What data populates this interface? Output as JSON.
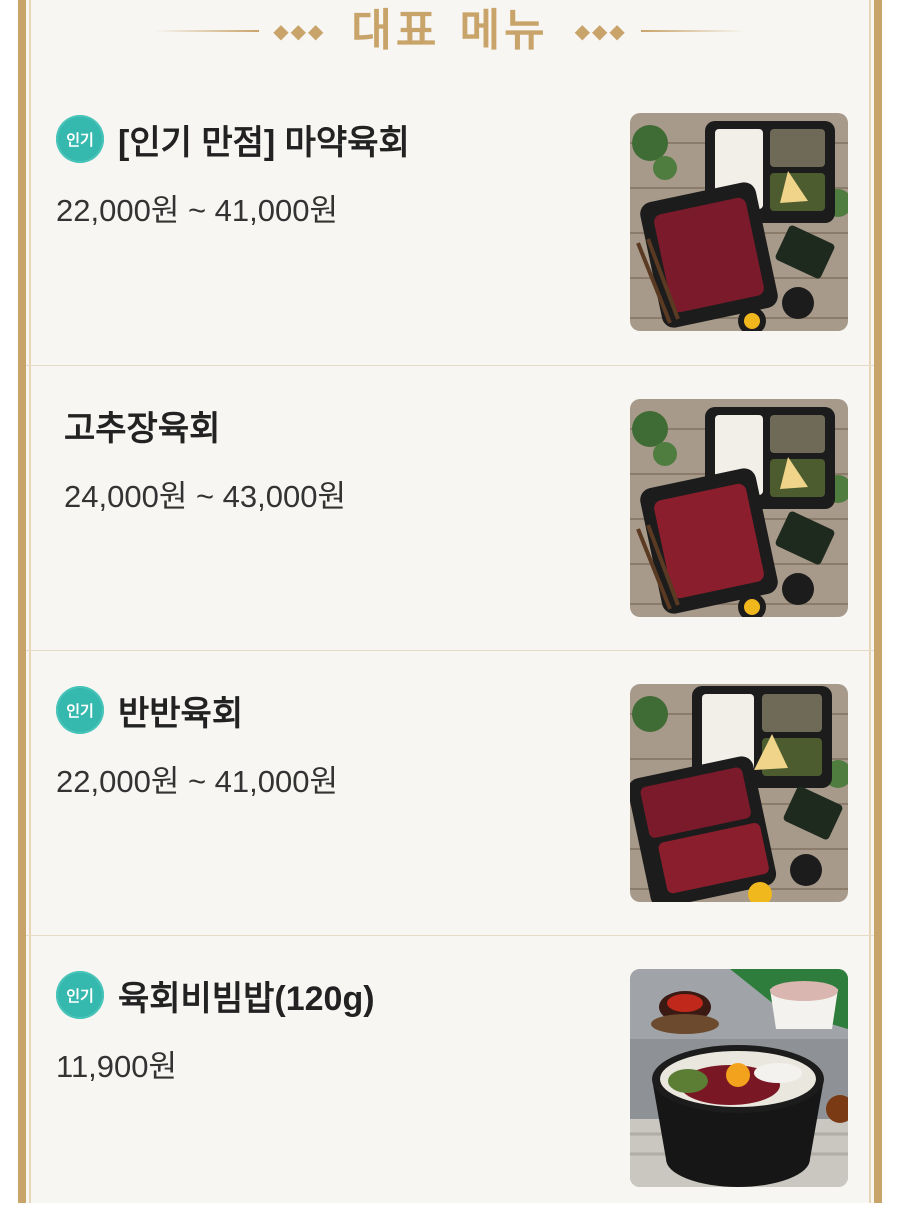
{
  "header": {
    "title": "대표 메뉴",
    "ornament_left": "◆◆◆",
    "ornament_right": "◆◆◆"
  },
  "colors": {
    "gold": "#c9a46a",
    "badge": "#35b8ad",
    "text": "#222222"
  },
  "menu": [
    {
      "badge": "인기",
      "name": "[인기 만점] 마약육회",
      "price": "22,000원 ~ 41,000원",
      "image": "yukhoe-set-icon"
    },
    {
      "badge": "",
      "name": "고추장육회",
      "price": "24,000원 ~ 43,000원",
      "image": "yukhoe-set-icon"
    },
    {
      "badge": "인기",
      "name": "반반육회",
      "price": "22,000원 ~ 41,000원",
      "image": "half-half-yukhoe-icon"
    },
    {
      "badge": "인기",
      "name": "육회비빔밥(120g)",
      "price": "11,900원",
      "image": "bibimbap-bowl-icon"
    }
  ]
}
